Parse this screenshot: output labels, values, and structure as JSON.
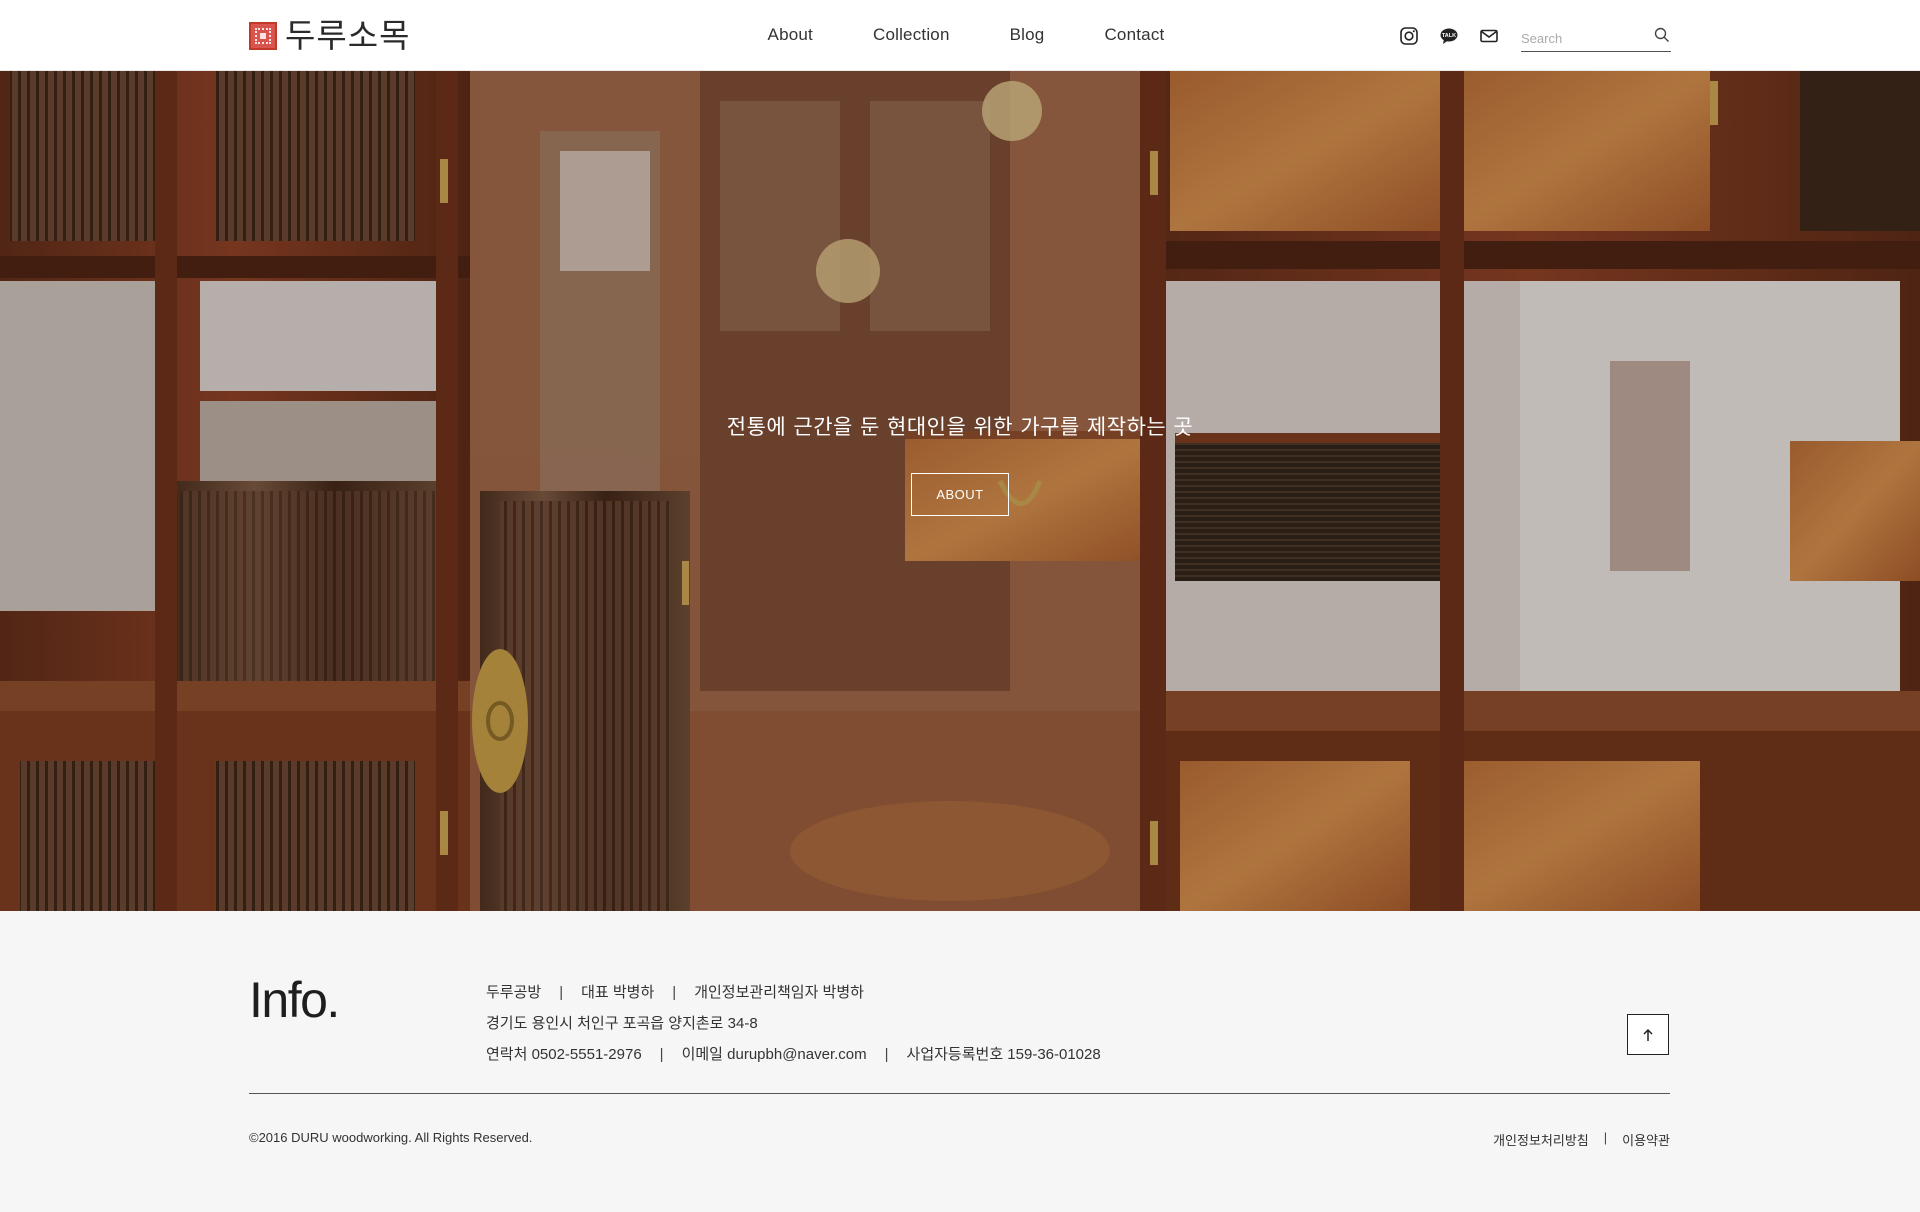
{
  "header": {
    "logo_text": "두루소목",
    "nav": [
      "About",
      "Collection",
      "Blog",
      "Contact"
    ],
    "icons": [
      "instagram-icon",
      "talk-chat-icon",
      "mail-icon"
    ],
    "search_placeholder": "Search"
  },
  "hero": {
    "tagline": "전통에 근간을 둔 현대인을 위한 가구를 제작하는 곳",
    "button_label": "ABOUT"
  },
  "footer": {
    "title": "Info.",
    "line1": [
      "두루공방",
      "대표 박병하",
      "개인정보관리책임자 박병하"
    ],
    "line2": "경기도 용인시 처인구 포곡읍 양지촌로 34-8",
    "line3": [
      "연락처 0502-5551-2976",
      "이메일 durupbh@naver.com",
      "사업자등록번호 159-36-01028"
    ],
    "separator": "|",
    "copyright": "©2016 DURU woodworking. All Rights Reserved.",
    "links": [
      "개인정보처리방침",
      "이용약관"
    ]
  },
  "colors": {
    "accent": "#d9534f",
    "wood": "#8a4a2a",
    "footer_bg": "#f6f6f6"
  }
}
